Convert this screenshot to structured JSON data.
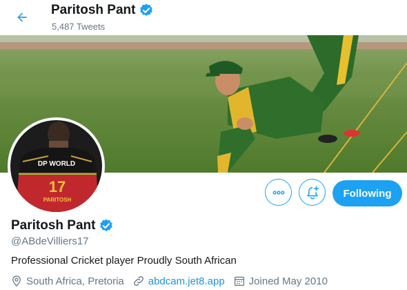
{
  "header": {
    "name": "Paritosh Pant",
    "tweet_count": "5,487 Tweets"
  },
  "avatar": {
    "jersey_sponsor": "DP WORLD",
    "jersey_number": "17",
    "jersey_name": "PARITOSH"
  },
  "actions": {
    "more_icon": "more-horizontal-icon",
    "notify_icon": "bell-plus-icon",
    "follow_label": "Following"
  },
  "profile": {
    "name": "Paritosh Pant",
    "handle": "@ABdeVilliers17",
    "bio": "Professional Cricket player Proudly South African",
    "location": "South Africa, Pretoria",
    "website": "abdcam.jet8.app",
    "joined": "Joined May 2010"
  },
  "colors": {
    "accent": "#1da1f2",
    "secondary_text": "#657786",
    "link": "#1b95e0"
  }
}
